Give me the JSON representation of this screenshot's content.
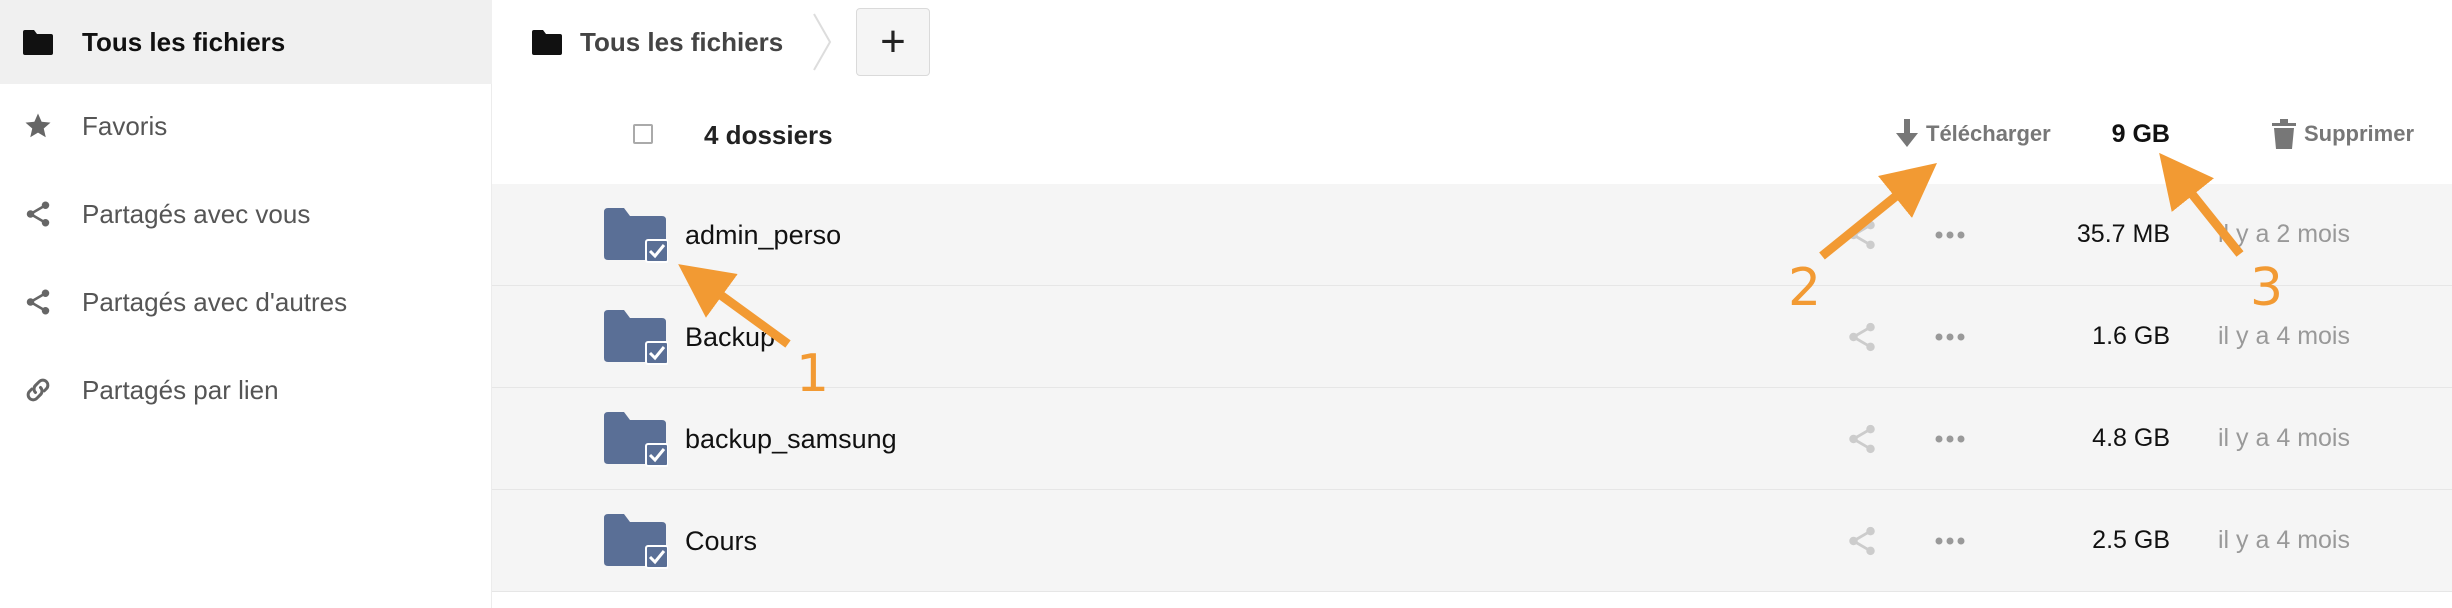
{
  "sidebar": {
    "items": [
      {
        "label": "Tous les fichiers",
        "icon": "folder-icon",
        "active": true
      },
      {
        "label": "Favoris",
        "icon": "star-icon",
        "active": false
      },
      {
        "label": "Partagés avec vous",
        "icon": "share-icon",
        "active": false
      },
      {
        "label": "Partagés avec d'autres",
        "icon": "share-icon",
        "active": false
      },
      {
        "label": "Partagés par lien",
        "icon": "link-icon",
        "active": false
      }
    ]
  },
  "breadcrumb": {
    "home_label": "Tous les fichiers",
    "new_button_label": "+"
  },
  "selection": {
    "count_label": "4 dossiers",
    "download_label": "Télécharger",
    "total_size": "9 GB",
    "delete_label": "Supprimer"
  },
  "files": [
    {
      "name": "admin_perso",
      "size": "35.7 MB",
      "modified": "il y a 2 mois",
      "selected": true
    },
    {
      "name": "Backup",
      "size": "1.6 GB",
      "modified": "il y a 4 mois",
      "selected": true
    },
    {
      "name": "backup_samsung",
      "size": "4.8 GB",
      "modified": "il y a 4 mois",
      "selected": true
    },
    {
      "name": "Cours",
      "size": "2.5 GB",
      "modified": "il y a 4 mois",
      "selected": true
    }
  ],
  "annotations": [
    {
      "label": "1"
    },
    {
      "label": "2"
    },
    {
      "label": "3"
    }
  ],
  "colors": {
    "accent_annotation": "#f29a33",
    "folder": "#5a6f96",
    "active_bg": "#f0f0f0",
    "row_bg": "#f5f5f5"
  }
}
